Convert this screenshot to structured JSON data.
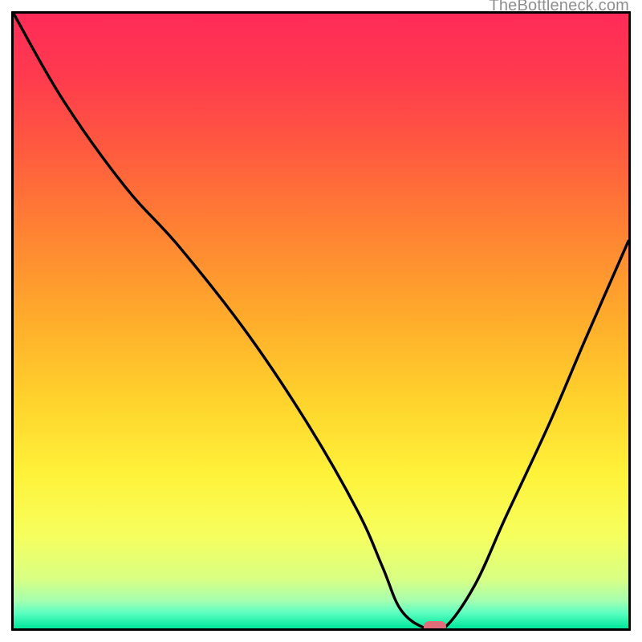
{
  "watermark": "TheBottleneck.com",
  "colors": {
    "gradient_stops": [
      {
        "offset": 0.0,
        "color": "#ff2b58"
      },
      {
        "offset": 0.1,
        "color": "#ff3a4e"
      },
      {
        "offset": 0.22,
        "color": "#ff5a3f"
      },
      {
        "offset": 0.35,
        "color": "#ff8133"
      },
      {
        "offset": 0.5,
        "color": "#ffad2b"
      },
      {
        "offset": 0.63,
        "color": "#ffd32c"
      },
      {
        "offset": 0.75,
        "color": "#fff23a"
      },
      {
        "offset": 0.85,
        "color": "#f6ff5e"
      },
      {
        "offset": 0.92,
        "color": "#d8ff84"
      },
      {
        "offset": 0.955,
        "color": "#a6ffb0"
      },
      {
        "offset": 0.975,
        "color": "#5bffc1"
      },
      {
        "offset": 1.0,
        "color": "#00e79c"
      }
    ],
    "curve": "#000000",
    "marker": "#e06d7a"
  },
  "chart_data": {
    "type": "line",
    "title": "",
    "xlabel": "",
    "ylabel": "",
    "xlim": [
      0,
      100
    ],
    "ylim": [
      0,
      100
    ],
    "series": [
      {
        "name": "bottleneck-curve",
        "x": [
          0,
          8,
          18,
          27,
          38,
          48,
          56,
          60,
          63,
          67,
          70,
          75,
          80,
          87,
          93,
          100
        ],
        "values": [
          100,
          86,
          72,
          62,
          48,
          33,
          19,
          10,
          3,
          0,
          0,
          7,
          18,
          33,
          47,
          63
        ]
      }
    ],
    "annotations": [
      {
        "name": "optimal-marker",
        "x": 68.5,
        "y": 0
      }
    ]
  }
}
